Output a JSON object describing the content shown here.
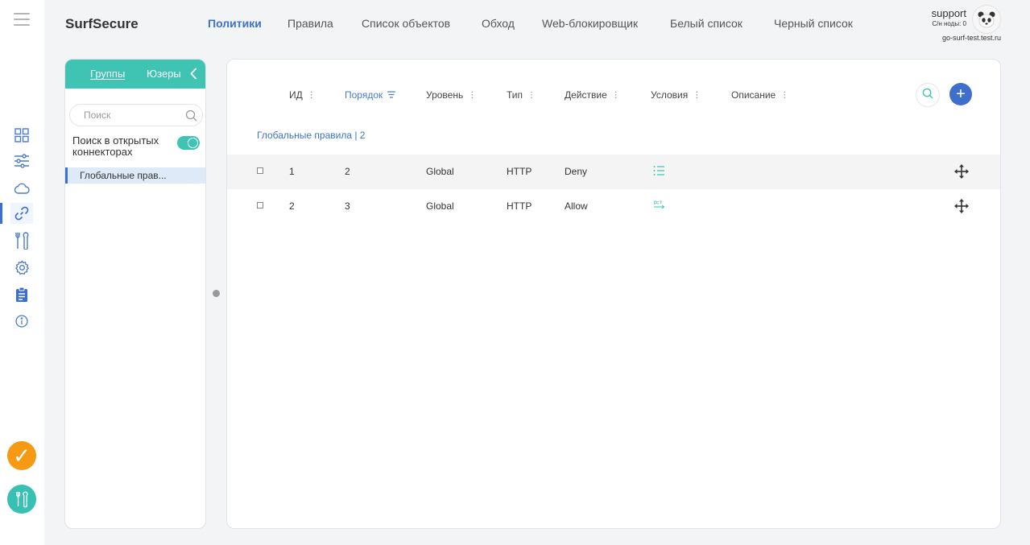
{
  "app": {
    "brand": "SurfSecure",
    "accent": "#3c72c9",
    "teal": "#3fc3b3"
  },
  "nav": [
    {
      "label": "Политики",
      "active": true
    },
    {
      "label": "Правила",
      "active": false
    },
    {
      "label": "Список объектов",
      "active": false
    },
    {
      "label": "Обход",
      "active": false
    },
    {
      "label": "Web-блокировщик",
      "active": false
    },
    {
      "label": "Белый список",
      "active": false
    },
    {
      "label": "Черный список",
      "active": false
    }
  ],
  "user": {
    "name": "support",
    "nodes": "С/н ноды: 0",
    "host": "go-surf-test.test.ru"
  },
  "sidebar": {
    "tabs": {
      "groups": "Группы",
      "users": "Юзеры"
    },
    "search_placeholder": "Поиск",
    "open_connectors_label": "Поиск в открытых коннекторах",
    "open_connectors_on": true,
    "groups": [
      "Глобальные прав..."
    ]
  },
  "rail_icons": [
    "dashboard-icon",
    "sliders-icon",
    "cloud-icon",
    "link-icon",
    "tools-icon",
    "gear-icon",
    "clipboard-icon",
    "info-icon"
  ],
  "table": {
    "columns": {
      "id": "ИД",
      "order": "Порядок",
      "level": "Уровень",
      "type": "Тип",
      "action": "Действие",
      "conditions": "Условия",
      "description": "Описание"
    },
    "group_title": "Глобальные правила | 2",
    "rows": [
      {
        "id": "1",
        "order": "2",
        "level": "Global",
        "type": "HTTP",
        "action": "Deny",
        "condition_icon": "list-icon"
      },
      {
        "id": "2",
        "order": "3",
        "level": "Global",
        "type": "HTTP",
        "action": "Allow",
        "condition_icon": "dst-icon"
      }
    ]
  }
}
